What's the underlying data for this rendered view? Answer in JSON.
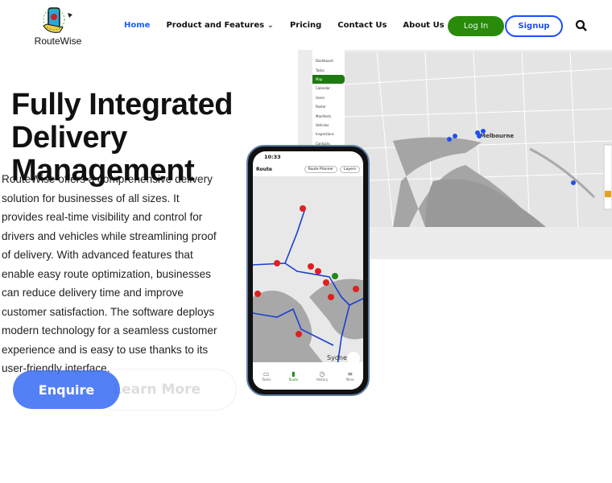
{
  "brand": {
    "name": "RouteWise"
  },
  "nav": {
    "items": [
      {
        "label": "Home",
        "active": true
      },
      {
        "label": "Product and Features",
        "dropdown": true
      },
      {
        "label": "Pricing"
      },
      {
        "label": "Contact Us"
      },
      {
        "label": "About Us"
      }
    ],
    "login": "Log In",
    "signup": "Signup",
    "search_icon": "search-icon"
  },
  "hero": {
    "title_lines": [
      "Fully Integrated",
      "Delivery",
      "Management"
    ],
    "body": "RouteWise offers a comprehensive delivery solution for businesses of all sizes. It provides real-time visibility and control for drivers and vehicles while streamlining proof of delivery. With advanced features that enable easy route optimization, businesses can reduce delivery time and improve customer satisfaction. The software deploys modern technology for a seamless customer experience and is easy to use thanks to its user-friendly interface.",
    "enquire": "Enquire",
    "learn_more": "Learn More"
  },
  "dashboard": {
    "sidebar": [
      "Dashboard",
      "Tasks",
      "Map",
      "Calendar",
      "Users",
      "Roster",
      "Manifests",
      "Vehicles",
      "Inspections",
      "Contacts"
    ],
    "active": "Map",
    "city": "Melbourne"
  },
  "phone": {
    "time": "10:33",
    "title": "Route",
    "route_planner": "Route Planner",
    "layers": "Layers",
    "city": "Sydney",
    "tabs": [
      {
        "label": "Tasks"
      },
      {
        "label": "Route",
        "active": true
      },
      {
        "label": "History"
      },
      {
        "label": "More"
      }
    ]
  },
  "colors": {
    "accent": "#1a5cff",
    "green": "#2a8a0a",
    "enquire": "#3c6ef5",
    "pin": "#e02020",
    "route": "#1a3fd0"
  }
}
